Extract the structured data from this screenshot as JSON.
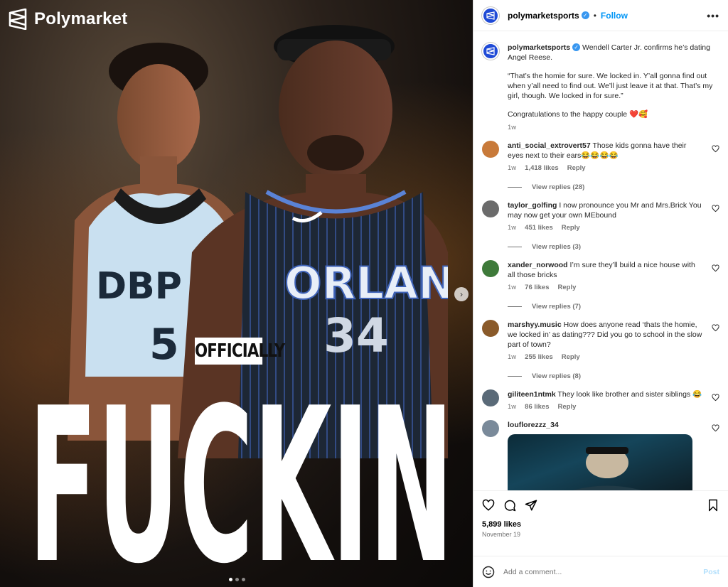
{
  "media": {
    "brand": "Polymarket",
    "overlay_small": "OFFICIALLY",
    "overlay_big": "FUCKIN",
    "carousel": {
      "total": 3,
      "active": 1
    }
  },
  "header": {
    "username": "polymarketsports",
    "follow": "Follow",
    "more": "•••"
  },
  "caption": {
    "username": "polymarketsports",
    "line1": "Wendell Carter Jr. confirms he’s dating Angel Reese.",
    "quote": "“That’s the homie for sure. We locked in. Y’all gonna find out when y’all need to find out. We’ll just leave it at that. That’s my girl, though. We locked in for sure.”",
    "congrats": "Congratulations to the happy couple ❤️🥰",
    "time": "1w"
  },
  "comments": [
    {
      "username": "anti_social_extrovert57",
      "text": "Those kids gonna have their eyes next to their ears😂😂😂😂",
      "time": "1w",
      "likes": "1,418 likes",
      "reply": "Reply",
      "replies": "View replies (28)",
      "avatar_color": "#c87a3a"
    },
    {
      "username": "taylor_golfing",
      "text": "I now pronounce you Mr and Mrs.Brick You may now get your own MEbound",
      "time": "1w",
      "likes": "451 likes",
      "reply": "Reply",
      "replies": "View replies (3)",
      "avatar_color": "#6b6b6b"
    },
    {
      "username": "xander_norwood",
      "text": "I’m sure they’ll build a nice house with all those bricks",
      "time": "1w",
      "likes": "76 likes",
      "reply": "Reply",
      "replies": "View replies (7)",
      "avatar_color": "#3e7a3a"
    },
    {
      "username": "marshyy.music",
      "text": "How does anyone read ‘thats the homie, we locked in’ as dating??? Did you go to school in the slow part of town?",
      "time": "1w",
      "likes": "255 likes",
      "reply": "Reply",
      "replies": "View replies (8)",
      "avatar_color": "#8a5a2a"
    },
    {
      "username": "giliteen1ntmk",
      "text": "They look like brother and sister siblings 😂",
      "time": "1w",
      "likes": "86 likes",
      "reply": "Reply",
      "replies": "",
      "avatar_color": "#5a6a78"
    },
    {
      "username": "louflorezzz_34",
      "text": "",
      "time": "",
      "likes": "",
      "reply": "",
      "replies": "",
      "avatar_color": "#7a8a9a"
    }
  ],
  "footer": {
    "likes": "5,899 likes",
    "date": "November 19",
    "comment_placeholder": "Add a comment...",
    "post": "Post"
  }
}
